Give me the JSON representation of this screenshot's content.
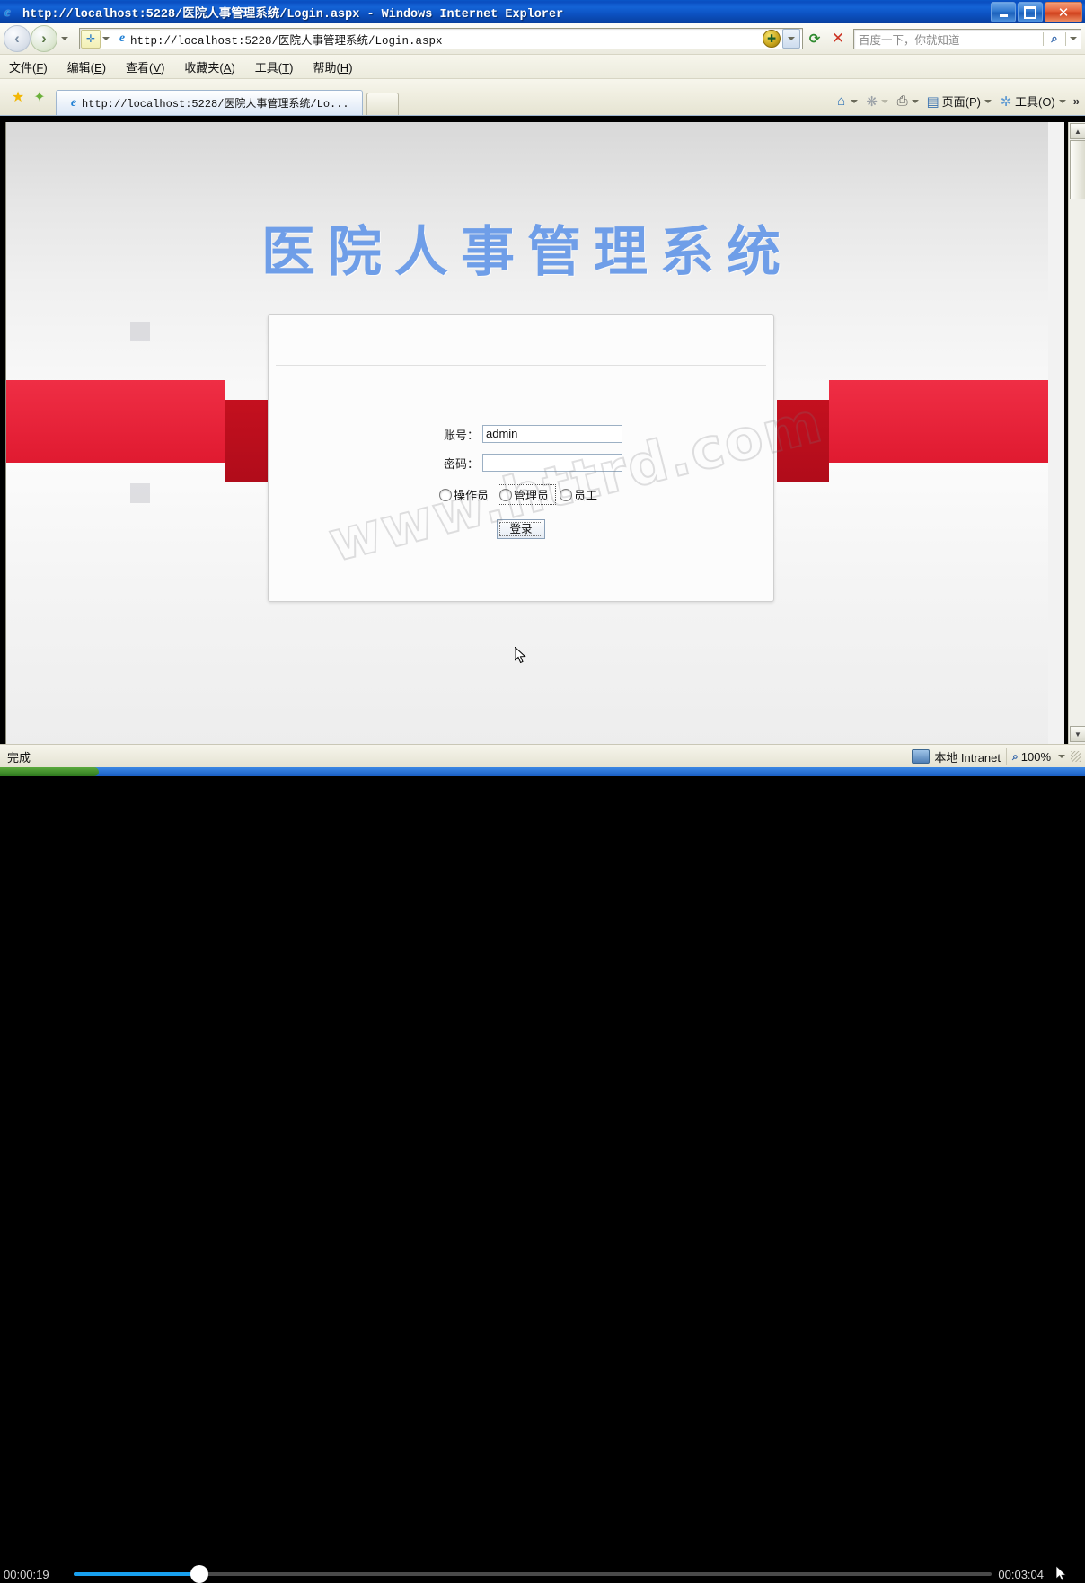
{
  "window": {
    "title": "http://localhost:5228/医院人事管理系统/Login.aspx - Windows Internet Explorer",
    "minimize_label": "最小化",
    "maximize_label": "还原",
    "close_label": "关闭"
  },
  "nav": {
    "back_label": "后退",
    "forward_label": "前进",
    "address_value": "http://localhost:5228/医院人事管理系统/Login.aspx",
    "refresh_label": "刷新",
    "stop_label": "停止",
    "search_placeholder": "百度一下，你就知道",
    "search_icon": "search-icon"
  },
  "menu": {
    "items": [
      {
        "text": "文件",
        "key": "F"
      },
      {
        "text": "编辑",
        "key": "E"
      },
      {
        "text": "查看",
        "key": "V"
      },
      {
        "text": "收藏夹",
        "key": "A"
      },
      {
        "text": "工具",
        "key": "T"
      },
      {
        "text": "帮助",
        "key": "H"
      }
    ]
  },
  "tabs": {
    "favorites_label": "收藏夹",
    "add_favorite_label": "添加到收藏夹",
    "items": [
      {
        "label": "http://localhost:5228/医院人事管理系统/Lo..."
      }
    ],
    "new_tab_label": "新选项卡",
    "toolbar": [
      {
        "name": "home-icon",
        "glyph": "⌂",
        "label": "",
        "caret": true
      },
      {
        "name": "feeds-icon",
        "glyph": "❋",
        "label": "",
        "caret": true
      },
      {
        "name": "print-icon",
        "glyph": "⎙",
        "label": "",
        "caret": true
      },
      {
        "name": "page-menu",
        "glyph": "▤",
        "label": "页面(P)",
        "caret": true
      },
      {
        "name": "tools-menu",
        "glyph": "✲",
        "label": "工具(O)",
        "caret": true
      }
    ],
    "overflow_label": "»"
  },
  "page": {
    "site_title": "医院人事管理系统",
    "watermark": "www.httrd.com",
    "login": {
      "fields": [
        {
          "name": "account",
          "label": "账号：",
          "value": "admin",
          "placeholder": ""
        },
        {
          "name": "password",
          "label": "密码：",
          "value": "",
          "placeholder": ""
        }
      ],
      "roles": [
        {
          "label": "操作员",
          "selected": false,
          "focused": false
        },
        {
          "label": "管理员",
          "selected": false,
          "focused": true
        },
        {
          "label": "员工",
          "selected": false,
          "focused": false
        }
      ],
      "submit_label": "登录"
    },
    "accent_color": "#ef2e45",
    "title_color": "#6f9ee8"
  },
  "status": {
    "text": "完成",
    "zone": "本地 Intranet",
    "zone_icon": "computer-icon",
    "zoom": "100%",
    "zoom_icon": "magnifier-icon"
  },
  "player": {
    "current_time": "00:00:19",
    "total_time": "00:03:04",
    "progress_percent": 10
  }
}
